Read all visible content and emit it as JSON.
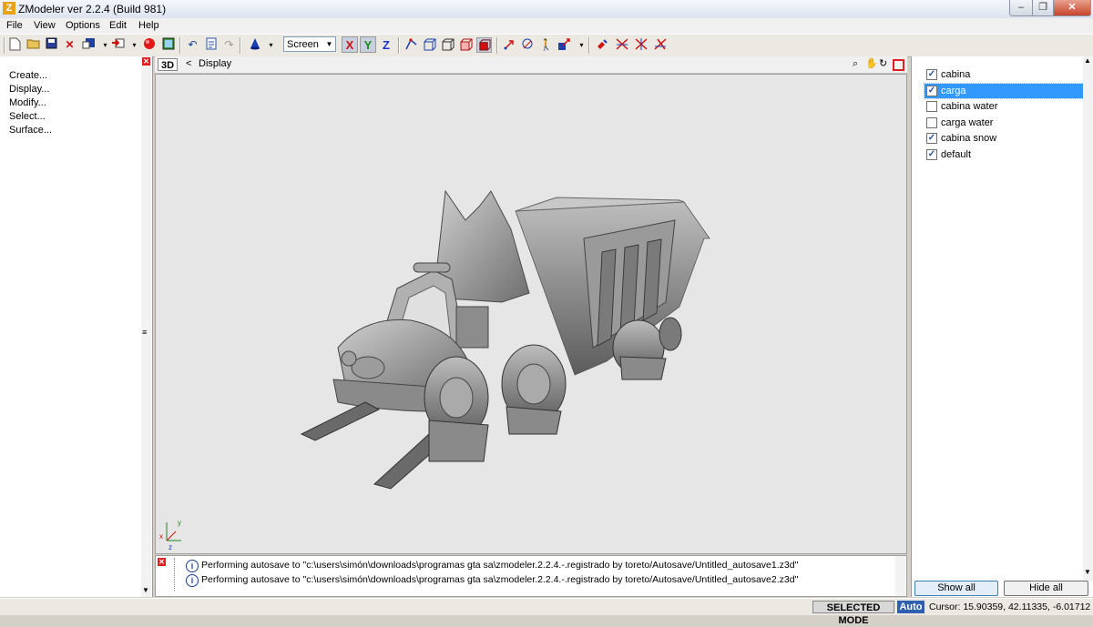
{
  "window": {
    "title": "ZModeler ver 2.2.4 (Build 981)",
    "app_icon": "Z"
  },
  "menu": [
    "File",
    "View",
    "Options",
    "Edit",
    "Help"
  ],
  "toolbar": {
    "icons": [
      "new-file-icon",
      "open-folder-icon",
      "save-icon",
      "delete-icon",
      "import-icon",
      "export-icon",
      "render-sphere-icon",
      "texture-icon",
      "undo-icon",
      "clipboard-icon",
      "redo-icon",
      "material-cone-icon"
    ],
    "coord_system": "Screen",
    "axes": [
      "X",
      "Y",
      "Z"
    ],
    "axis_colors": {
      "X": "#cc1010",
      "Y": "#1a8a1a",
      "Z": "#1a2fcc"
    }
  },
  "left_panel": {
    "items": [
      "Create...",
      "Display...",
      "Modify...",
      "Select...",
      "Surface..."
    ]
  },
  "viewport": {
    "mode_label": "3D",
    "back_glyph": "<",
    "breadcrumb": "Display",
    "bg_color": "#e6e6e6"
  },
  "log": {
    "lines": [
      "Performing autosave to \"c:\\users\\simón\\downloads\\programas gta sa\\zmodeler.2.2.4.-.registrado by toreto/Autosave/Untitled_autosave1.z3d\"",
      "Performing autosave to \"c:\\users\\simón\\downloads\\programas gta sa\\zmodeler.2.2.4.-.registrado by toreto/Autosave/Untitled_autosave2.z3d\""
    ]
  },
  "objects": [
    {
      "name": "cabina",
      "checked": true,
      "selected": false
    },
    {
      "name": "carga",
      "checked": true,
      "selected": true
    },
    {
      "name": "cabina water",
      "checked": false,
      "selected": false
    },
    {
      "name": "carga water",
      "checked": false,
      "selected": false
    },
    {
      "name": "cabina snow",
      "checked": true,
      "selected": false
    },
    {
      "name": "default",
      "checked": true,
      "selected": false
    }
  ],
  "object_buttons": {
    "show_all": "Show all",
    "hide_all": "Hide all"
  },
  "status": {
    "mode": "SELECTED MODE",
    "auto": "Auto",
    "cursor": "Cursor: 15.90359, 42.11335, -6.01712"
  },
  "colors": {
    "selection": "#3399ff",
    "close_red": "#e02020"
  }
}
